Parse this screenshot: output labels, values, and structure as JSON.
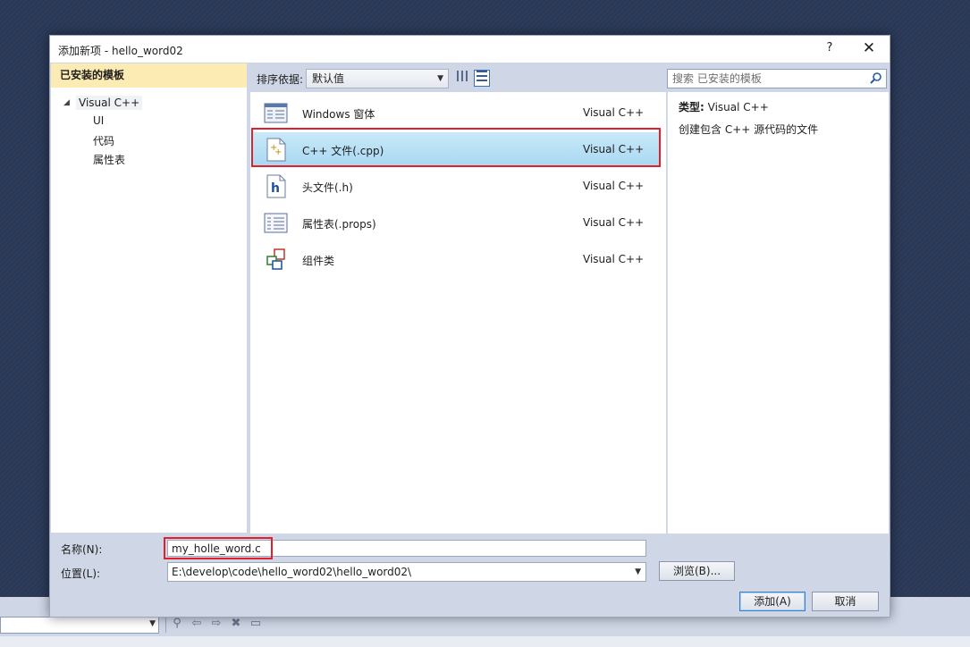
{
  "dialog": {
    "title": "添加新项 - hello_word02",
    "help": "?",
    "close": "✕"
  },
  "left": {
    "header": "已安装的模板",
    "tree": {
      "root": "Visual C++",
      "toggle": "◢",
      "children": [
        "UI",
        "代码",
        "属性表"
      ]
    }
  },
  "toolbar": {
    "sort_label": "排序依据:",
    "sort_value": "默认值",
    "search_placeholder": "搜索 已安装的模板"
  },
  "templates": [
    {
      "name": "Windows 窗体",
      "lang": "Visual C++",
      "icon": "windows-form-icon",
      "selected": false
    },
    {
      "name": "C++ 文件(.cpp)",
      "lang": "Visual C++",
      "icon": "cpp-file-icon",
      "selected": true
    },
    {
      "name": "头文件(.h)",
      "lang": "Visual C++",
      "icon": "header-file-icon",
      "selected": false
    },
    {
      "name": "属性表(.props)",
      "lang": "Visual C++",
      "icon": "property-sheet-icon",
      "selected": false
    },
    {
      "name": "组件类",
      "lang": "Visual C++",
      "icon": "component-class-icon",
      "selected": false
    }
  ],
  "details": {
    "type_label": "类型:",
    "type_value": " Visual C++",
    "description": "创建包含 C++ 源代码的文件"
  },
  "form": {
    "name_label": "名称(N):",
    "name_value": "my_holle_word.c",
    "location_label": "位置(L):",
    "location_value": "E:\\develop\\code\\hello_word02\\hello_word02\\",
    "browse": "浏览(B)...",
    "add": "添加(A)",
    "cancel": "取消"
  },
  "colors": {
    "highlight": "#e0202a",
    "selected_row": "#a8d8f2",
    "left_header": "#fcecb3"
  }
}
